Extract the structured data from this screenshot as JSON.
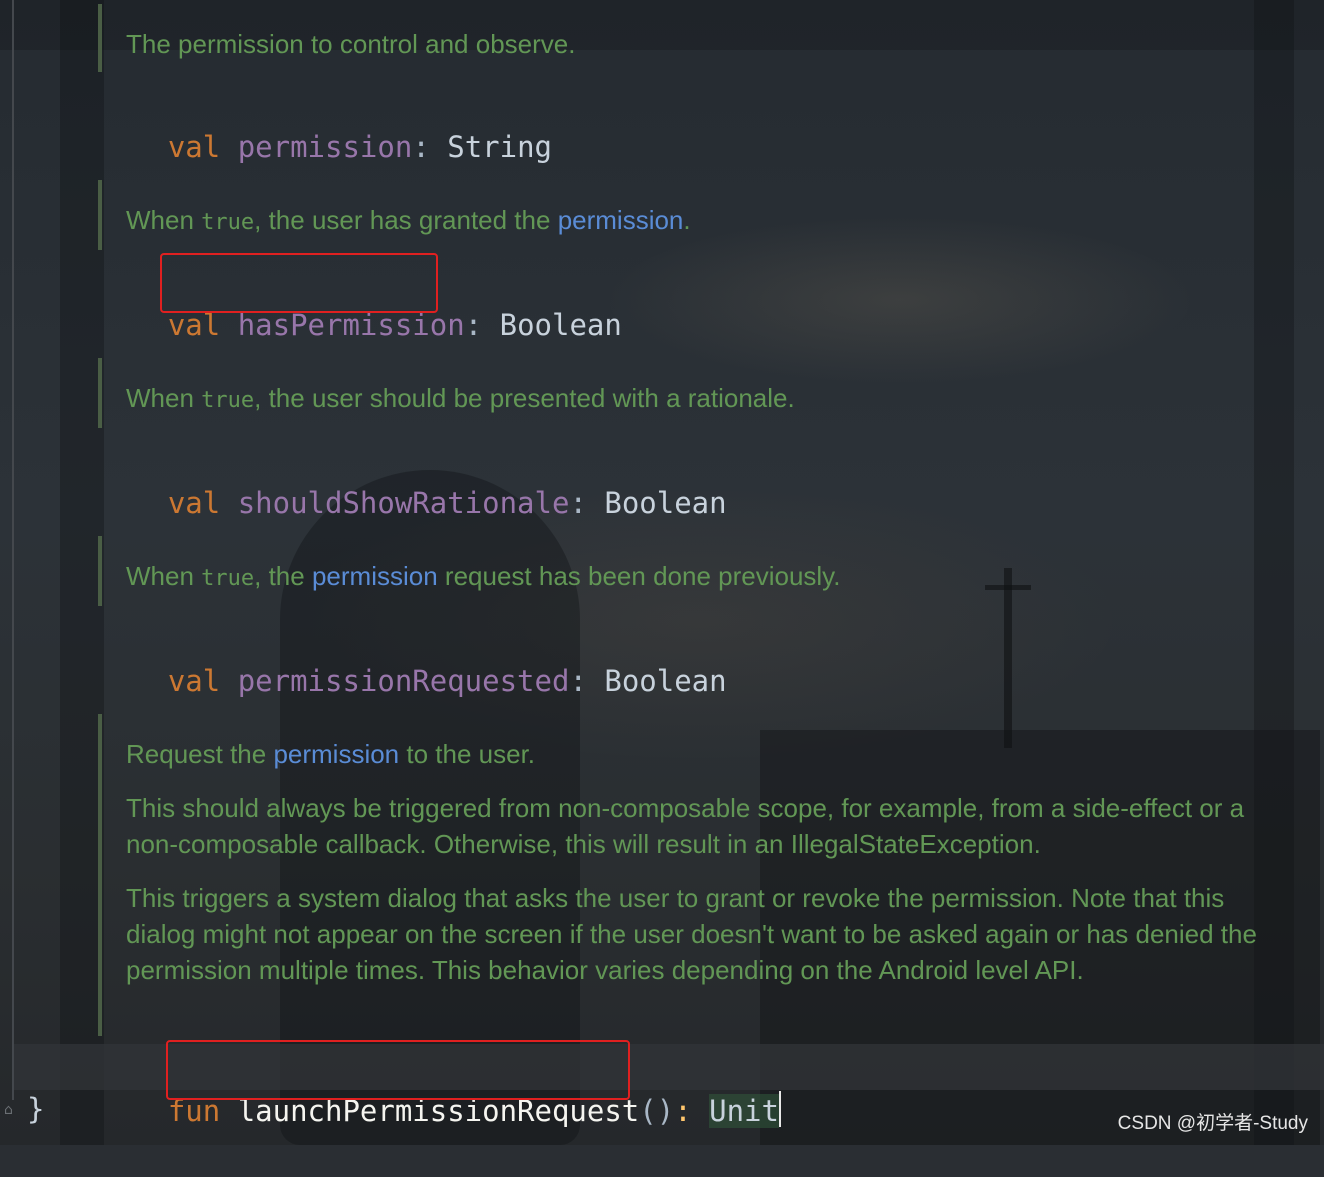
{
  "docs": [
    {
      "parts": [
        {
          "t": "The permission to control and observe.",
          "k": "text"
        }
      ]
    },
    {
      "parts": [
        {
          "t": "When ",
          "k": "text"
        },
        {
          "t": "true",
          "k": "mono"
        },
        {
          "t": ", the user has granted the ",
          "k": "text"
        },
        {
          "t": "permission",
          "k": "link"
        },
        {
          "t": ".",
          "k": "text"
        }
      ]
    },
    {
      "parts": [
        {
          "t": "When ",
          "k": "text"
        },
        {
          "t": "true",
          "k": "mono"
        },
        {
          "t": ", the user should be presented with a rationale.",
          "k": "text"
        }
      ]
    },
    {
      "parts": [
        {
          "t": "When ",
          "k": "text"
        },
        {
          "t": "true",
          "k": "mono"
        },
        {
          "t": ", the ",
          "k": "text"
        },
        {
          "t": "permission",
          "k": "link"
        },
        {
          "t": " request has been done previously.",
          "k": "text"
        }
      ]
    }
  ],
  "decls": [
    {
      "keyword": "val",
      "name": "permission",
      "colon": ":",
      "type": "String"
    },
    {
      "keyword": "val",
      "name": "hasPermission",
      "colon": ":",
      "type": "Boolean"
    },
    {
      "keyword": "val",
      "name": "shouldShowRationale",
      "colon": ":",
      "type": "Boolean"
    },
    {
      "keyword": "val",
      "name": "permissionRequested",
      "colon": ":",
      "type": "Boolean"
    }
  ],
  "launch_doc": {
    "p1": {
      "a": "Request the ",
      "link": "permission",
      "b": " to the user."
    },
    "p2": "This should always be triggered from non-composable scope, for example, from a side-effect or a non-composable callback. Otherwise, this will result in an IllegalStateException.",
    "p3": "This triggers a system dialog that asks the user to grant or revoke the permission. Note that this dialog might not appear on the screen if the user doesn't want to be asked again or has denied the permission multiple times. This behavior varies depending on the Android level API."
  },
  "fun_decl": {
    "keyword": "fun",
    "name": "launchPermissionRequest",
    "parens": "()",
    "colon": ":",
    "type": "Unit"
  },
  "closing_brace": "}",
  "fold_icon": "fold-marker-icon",
  "watermark": "CSDN @初学者-Study",
  "colors": {
    "keyword": "#cc7832",
    "property": "#9876aa",
    "doc_comment": "#629755",
    "doc_link": "#5a8cd6",
    "highlight_box": "#e02020"
  }
}
